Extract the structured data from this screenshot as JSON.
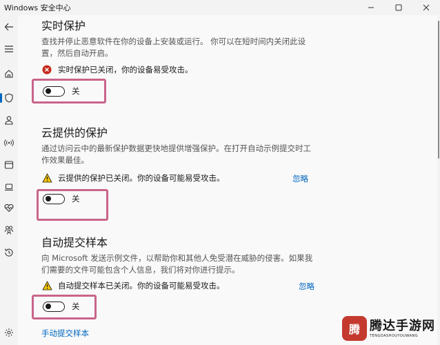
{
  "window": {
    "title": "Windows 安全中心",
    "minimize_icon": "minimize-icon",
    "maximize_icon": "maximize-icon",
    "close_icon": "close-icon"
  },
  "sidebar": {
    "items": [
      {
        "icon": "back-arrow-icon"
      },
      {
        "icon": "hamburger-menu-icon"
      },
      {
        "icon": "home-icon"
      },
      {
        "icon": "shield-icon"
      },
      {
        "icon": "person-icon"
      },
      {
        "icon": "wifi-antenna-icon"
      },
      {
        "icon": "app-browser-icon"
      },
      {
        "icon": "laptop-icon"
      },
      {
        "icon": "heart-health-icon"
      },
      {
        "icon": "family-icon"
      },
      {
        "icon": "history-icon"
      },
      {
        "icon": "settings-gear-icon"
      }
    ]
  },
  "sections": [
    {
      "title": "实时保护",
      "description": "查找并停止恶意软件在你的设备上安装或运行。 你可以在短时间内关闭此设置，然后自动开启。",
      "status": "实时保护已关闭，你的设备易受攻击。",
      "status_type": "error",
      "toggle_label": "关",
      "toggle_on": false,
      "dismiss": ""
    },
    {
      "title": "云提供的保护",
      "description": "通过访问云中的最新保护数据更快地提供增强保护。在打开自动示例提交时工作效果最佳。",
      "status": "云提供的保护已关闭。你的设备可能易受攻击。",
      "status_type": "warning",
      "toggle_label": "关",
      "toggle_on": false,
      "dismiss": "忽略"
    },
    {
      "title": "自动提交样本",
      "description": "向 Microsoft 发送示例文件，以帮助你和其他人免受潜在威胁的侵害。如果我们需要的文件可能包含个人信息，我们将对你进行提示。",
      "status": "自动提交样本已关闭。你的设备可能易受攻击。",
      "status_type": "warning",
      "toggle_label": "关",
      "toggle_on": false,
      "dismiss": "忽略"
    }
  ],
  "manual_submit_link": "手动提交样本",
  "colors": {
    "accent": "#0067c0",
    "error": "#c42b1c",
    "warning": "#f7c500",
    "highlight": "#c9648a"
  },
  "watermark": {
    "logo_text": "腾",
    "main": "腾达手游网",
    "sub": "TENGDASHOUYOUWANG"
  }
}
